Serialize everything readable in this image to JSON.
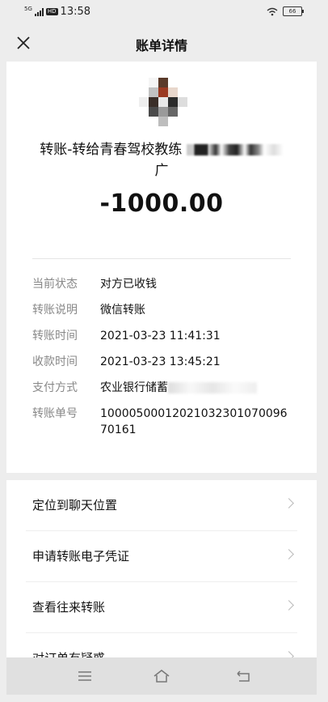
{
  "status_bar": {
    "network": "5G",
    "hd": "HD",
    "time": "13:58",
    "battery": "66"
  },
  "header": {
    "title": "账单详情"
  },
  "transfer": {
    "payee_line1": "转账-转给青春驾校教练",
    "payee_line2": "广",
    "amount": "-1000.00"
  },
  "details": [
    {
      "key": "当前状态",
      "value": "对方已收钱"
    },
    {
      "key": "转账说明",
      "value": "微信转账"
    },
    {
      "key": "转账时间",
      "value": "2021-03-23 11:41:31"
    },
    {
      "key": "收款时间",
      "value": "2021-03-23 13:45:21"
    },
    {
      "key": "支付方式",
      "value": "农业银行储蓄"
    },
    {
      "key": "转账单号",
      "value": "1000050001202103230107009670161"
    }
  ],
  "menu": [
    {
      "label": "定位到聊天位置"
    },
    {
      "label": "申请转账电子凭证"
    },
    {
      "label": "查看往来转账"
    },
    {
      "label": "对订单有疑惑"
    }
  ]
}
